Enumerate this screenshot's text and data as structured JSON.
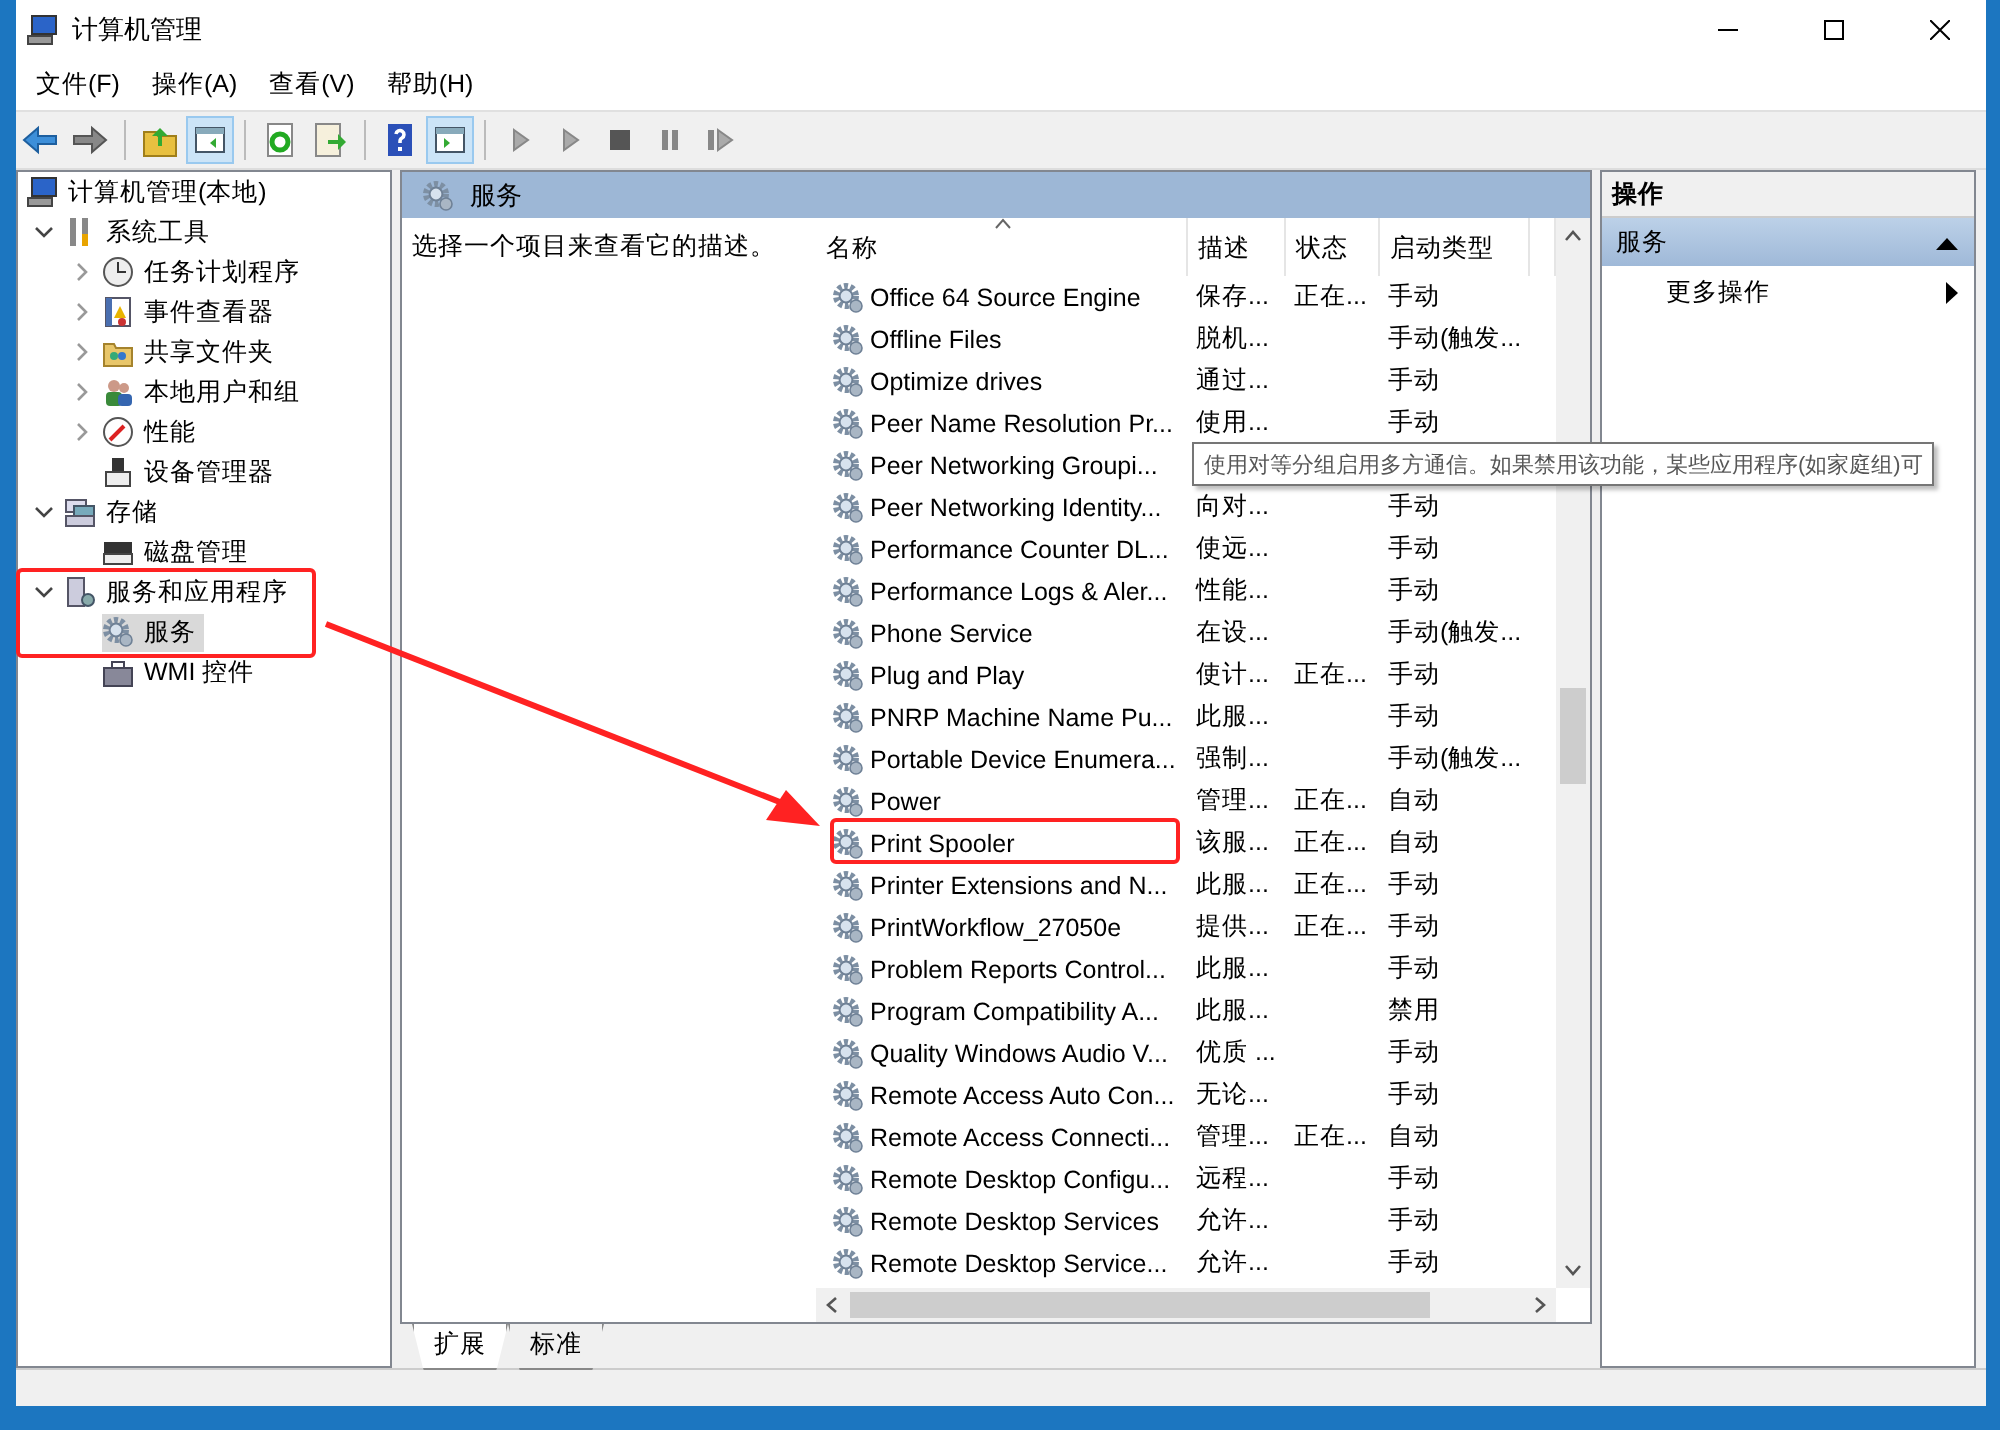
{
  "window": {
    "title": "计算机管理"
  },
  "menu": [
    {
      "label": "文件(F)"
    },
    {
      "label": "操作(A)"
    },
    {
      "label": "查看(V)"
    },
    {
      "label": "帮助(H)"
    }
  ],
  "toolbar": [
    {
      "kind": "back",
      "pressed": false
    },
    {
      "kind": "forward",
      "pressed": false
    },
    {
      "kind": "sep"
    },
    {
      "kind": "up",
      "pressed": false
    },
    {
      "kind": "tree",
      "pressed": true
    },
    {
      "kind": "sep"
    },
    {
      "kind": "refresh",
      "pressed": false
    },
    {
      "kind": "export",
      "pressed": false
    },
    {
      "kind": "sep"
    },
    {
      "kind": "help",
      "pressed": false
    },
    {
      "kind": "actions",
      "pressed": true
    },
    {
      "kind": "sep"
    },
    {
      "kind": "play",
      "pressed": false
    },
    {
      "kind": "play",
      "pressed": false
    },
    {
      "kind": "stop",
      "pressed": false
    },
    {
      "kind": "pause",
      "pressed": false
    },
    {
      "kind": "resume",
      "pressed": false
    }
  ],
  "tree": [
    {
      "label": "计算机管理(本地)",
      "kind": "computer",
      "selected": false,
      "children": [
        {
          "label": "系统工具",
          "kind": "tools",
          "selected": false,
          "expanded": true,
          "children": [
            {
              "label": "任务计划程序",
              "kind": "clock",
              "selected": false,
              "expanded": false
            },
            {
              "label": "事件查看器",
              "kind": "event",
              "selected": false,
              "expanded": false
            },
            {
              "label": "共享文件夹",
              "kind": "share",
              "selected": false,
              "expanded": false
            },
            {
              "label": "本地用户和组",
              "kind": "users",
              "selected": false,
              "expanded": false
            },
            {
              "label": "性能",
              "kind": "perf",
              "selected": false,
              "expanded": false
            },
            {
              "label": "设备管理器",
              "kind": "device",
              "selected": false
            }
          ]
        },
        {
          "label": "存储",
          "kind": "storage",
          "selected": false,
          "expanded": true,
          "children": [
            {
              "label": "磁盘管理",
              "kind": "disk",
              "selected": false
            }
          ]
        },
        {
          "label": "服务和应用程序",
          "kind": "apps",
          "selected": false,
          "expanded": true,
          "children": [
            {
              "label": "服务",
              "kind": "services",
              "selected": true
            },
            {
              "label": "WMI 控件",
              "kind": "wmi",
              "selected": false
            }
          ]
        }
      ]
    }
  ],
  "middle": {
    "title": "服务",
    "description": "选择一个项目来查看它的描述。",
    "columns": [
      {
        "label": "名称",
        "sorted": true
      },
      {
        "label": "描述",
        "sorted": false
      },
      {
        "label": "状态",
        "sorted": false
      },
      {
        "label": "启动类型",
        "sorted": false
      }
    ],
    "rows": [
      {
        "cells": [
          "Office 64 Source Engine",
          "保存...",
          "正在...",
          "手动"
        ]
      },
      {
        "cells": [
          "Offline Files",
          "脱机...",
          "",
          "手动(触发..."
        ]
      },
      {
        "cells": [
          "Optimize drives",
          "通过...",
          "",
          "手动"
        ]
      },
      {
        "cells": [
          "Peer Name Resolution Pr...",
          "使用...",
          "",
          "手动"
        ]
      },
      {
        "cells": [
          "Peer Networking Groupi..."
        ]
      },
      {
        "cells": [
          "Peer Networking Identity...",
          "向对...",
          "",
          "手动"
        ]
      },
      {
        "cells": [
          "Performance Counter DL...",
          "使远...",
          "",
          "手动"
        ]
      },
      {
        "cells": [
          "Performance Logs & Aler...",
          "性能...",
          "",
          "手动"
        ]
      },
      {
        "cells": [
          "Phone Service",
          "在设...",
          "",
          "手动(触发..."
        ]
      },
      {
        "cells": [
          "Plug and Play",
          "使计...",
          "正在...",
          "手动"
        ]
      },
      {
        "cells": [
          "PNRP Machine Name Pu...",
          "此服...",
          "",
          "手动"
        ]
      },
      {
        "cells": [
          "Portable Device Enumera...",
          "强制...",
          "",
          "手动(触发..."
        ]
      },
      {
        "cells": [
          "Power",
          "管理...",
          "正在...",
          "自动"
        ]
      },
      {
        "cells": [
          "Print Spooler",
          "该服...",
          "正在...",
          "自动"
        ]
      },
      {
        "cells": [
          "Printer Extensions and N...",
          "此服...",
          "正在...",
          "手动"
        ]
      },
      {
        "cells": [
          "PrintWorkflow_27050e",
          "提供...",
          "正在...",
          "手动"
        ]
      },
      {
        "cells": [
          "Problem Reports Control...",
          "此服...",
          "",
          "手动"
        ]
      },
      {
        "cells": [
          "Program Compatibility A...",
          "此服...",
          "",
          "禁用"
        ]
      },
      {
        "cells": [
          "Quality Windows Audio V...",
          "优质 ...",
          "",
          "手动"
        ]
      },
      {
        "cells": [
          "Remote Access Auto Con...",
          "无论...",
          "",
          "手动"
        ]
      },
      {
        "cells": [
          "Remote Access Connecti...",
          "管理...",
          "正在...",
          "自动"
        ]
      },
      {
        "cells": [
          "Remote Desktop Configu...",
          "远程...",
          "",
          "手动"
        ]
      },
      {
        "cells": [
          "Remote Desktop Services",
          "允许...",
          "",
          "手动"
        ]
      },
      {
        "cells": [
          "Remote Desktop Service...",
          "允许...",
          "",
          "手动"
        ]
      }
    ],
    "tooltip": "使用对等分组启用多方通信。如果禁用该功能，某些应用程序(如家庭组)可",
    "tabs": [
      {
        "label": "扩展",
        "selected": true
      },
      {
        "label": "标准",
        "selected": false
      }
    ]
  },
  "actions": {
    "title": "操作",
    "section": {
      "label": "服务",
      "expanded": true
    },
    "items": [
      {
        "label": "更多操作"
      }
    ]
  }
}
